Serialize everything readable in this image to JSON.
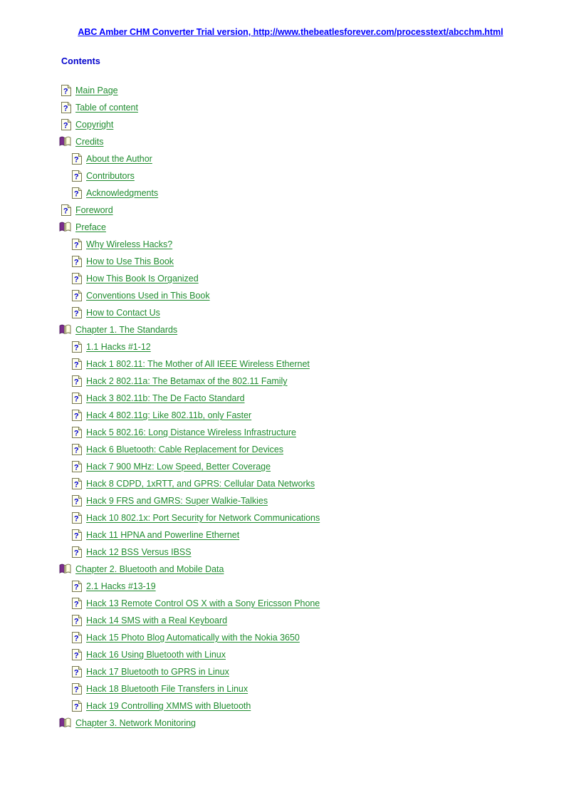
{
  "banner": {
    "text": "ABC Amber CHM Converter Trial version, http://www.thebeatlesforever.com/processtext/abcchm.html",
    "color": "#0000ff"
  },
  "heading": {
    "text": "Contents",
    "color": "#0000cc"
  },
  "colors": {
    "link": "#1f8c2f",
    "banner_link": "#0000ff",
    "heading": "#0000cc",
    "page_icon_border": "#7a7a52",
    "page_icon_fill": "#fffff0",
    "page_icon_glyph": "#0000cc",
    "book_icon_cover": "#7b2f8c",
    "book_icon_page": "#ffffcc",
    "background": "#ffffff"
  },
  "toc": {
    "items": [
      {
        "label": "Main Page",
        "level": 1,
        "icon": "page-question-icon"
      },
      {
        "label": "Table of content",
        "level": 1,
        "icon": "page-question-icon"
      },
      {
        "label": "Copyright",
        "level": 1,
        "icon": "page-question-icon"
      },
      {
        "label": "Credits",
        "level": 1,
        "icon": "open-book-icon"
      },
      {
        "label": "About the Author",
        "level": 2,
        "icon": "page-question-icon"
      },
      {
        "label": "Contributors",
        "level": 2,
        "icon": "page-question-icon"
      },
      {
        "label": "Acknowledgments",
        "level": 2,
        "icon": "page-question-icon"
      },
      {
        "label": "Foreword",
        "level": 1,
        "icon": "page-question-icon"
      },
      {
        "label": "Preface",
        "level": 1,
        "icon": "open-book-icon"
      },
      {
        "label": "Why Wireless Hacks?",
        "level": 2,
        "icon": "page-question-icon"
      },
      {
        "label": "How to Use This Book",
        "level": 2,
        "icon": "page-question-icon"
      },
      {
        "label": "How This Book Is Organized",
        "level": 2,
        "icon": "page-question-icon"
      },
      {
        "label": "Conventions Used in This Book",
        "level": 2,
        "icon": "page-question-icon"
      },
      {
        "label": "How to Contact Us",
        "level": 2,
        "icon": "page-question-icon"
      },
      {
        "label": "Chapter 1. The Standards",
        "level": 1,
        "icon": "open-book-icon"
      },
      {
        "label": "1.1 Hacks #1-12",
        "level": 2,
        "icon": "page-question-icon"
      },
      {
        "label": "Hack 1 802.11: The Mother of All IEEE Wireless Ethernet",
        "level": 2,
        "icon": "page-question-icon"
      },
      {
        "label": "Hack 2 802.11a: The Betamax of the 802.11 Family",
        "level": 2,
        "icon": "page-question-icon"
      },
      {
        "label": "Hack 3 802.11b: The De Facto Standard",
        "level": 2,
        "icon": "page-question-icon"
      },
      {
        "label": "Hack 4 802.11g: Like 802.11b, only Faster",
        "level": 2,
        "icon": "page-question-icon"
      },
      {
        "label": "Hack 5 802.16: Long Distance Wireless Infrastructure",
        "level": 2,
        "icon": "page-question-icon"
      },
      {
        "label": "Hack 6 Bluetooth: Cable Replacement for Devices",
        "level": 2,
        "icon": "page-question-icon"
      },
      {
        "label": "Hack 7 900 MHz: Low Speed, Better Coverage",
        "level": 2,
        "icon": "page-question-icon"
      },
      {
        "label": "Hack 8 CDPD, 1xRTT, and GPRS: Cellular Data Networks",
        "level": 2,
        "icon": "page-question-icon"
      },
      {
        "label": "Hack 9 FRS and GMRS: Super Walkie-Talkies",
        "level": 2,
        "icon": "page-question-icon"
      },
      {
        "label": "Hack 10 802.1x: Port Security for Network Communications",
        "level": 2,
        "icon": "page-question-icon"
      },
      {
        "label": "Hack 11 HPNA and Powerline Ethernet",
        "level": 2,
        "icon": "page-question-icon"
      },
      {
        "label": "Hack 12 BSS Versus IBSS",
        "level": 2,
        "icon": "page-question-icon"
      },
      {
        "label": "Chapter 2. Bluetooth and Mobile Data",
        "level": 1,
        "icon": "open-book-icon"
      },
      {
        "label": "2.1 Hacks #13-19",
        "level": 2,
        "icon": "page-question-icon"
      },
      {
        "label": "Hack 13 Remote Control OS X with a Sony Ericsson Phone",
        "level": 2,
        "icon": "page-question-icon"
      },
      {
        "label": "Hack 14 SMS with a Real Keyboard",
        "level": 2,
        "icon": "page-question-icon"
      },
      {
        "label": "Hack 15 Photo Blog Automatically with the Nokia 3650",
        "level": 2,
        "icon": "page-question-icon"
      },
      {
        "label": "Hack 16 Using Bluetooth with Linux",
        "level": 2,
        "icon": "page-question-icon"
      },
      {
        "label": "Hack 17 Bluetooth to GPRS in Linux",
        "level": 2,
        "icon": "page-question-icon"
      },
      {
        "label": "Hack 18 Bluetooth File Transfers in Linux",
        "level": 2,
        "icon": "page-question-icon"
      },
      {
        "label": "Hack 19 Controlling XMMS with Bluetooth",
        "level": 2,
        "icon": "page-question-icon"
      },
      {
        "label": "Chapter 3. Network Monitoring",
        "level": 1,
        "icon": "open-book-icon"
      }
    ]
  }
}
